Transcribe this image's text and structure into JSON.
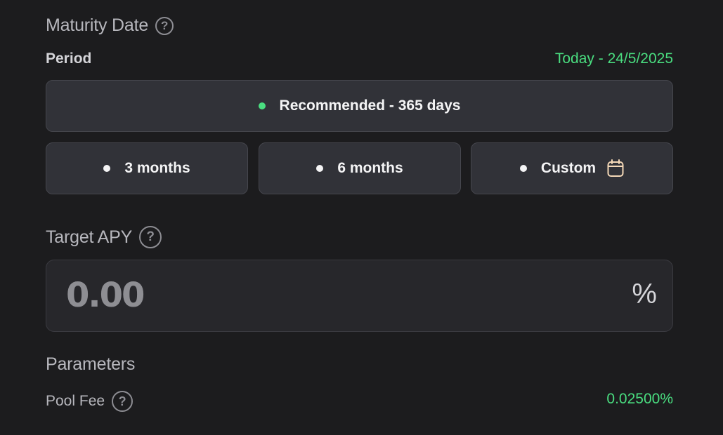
{
  "maturity": {
    "title": "Maturity Date",
    "help": "?",
    "period_label": "Period",
    "period_value": "Today - 24/5/2025",
    "options": {
      "recommended": "Recommended - 365 days",
      "three_months": "3 months",
      "six_months": "6 months",
      "custom": "Custom"
    },
    "custom_icon": "calendar-icon"
  },
  "apy": {
    "title": "Target APY",
    "help": "?",
    "placeholder": "0.00",
    "suffix": "%"
  },
  "parameters": {
    "title": "Parameters",
    "pool_fee_label": "Pool Fee",
    "help": "?",
    "pool_fee_value": "0.02500%"
  },
  "colors": {
    "background": "#1c1c1e",
    "accent_green": "#4ade80",
    "option_bg": "#313238"
  }
}
